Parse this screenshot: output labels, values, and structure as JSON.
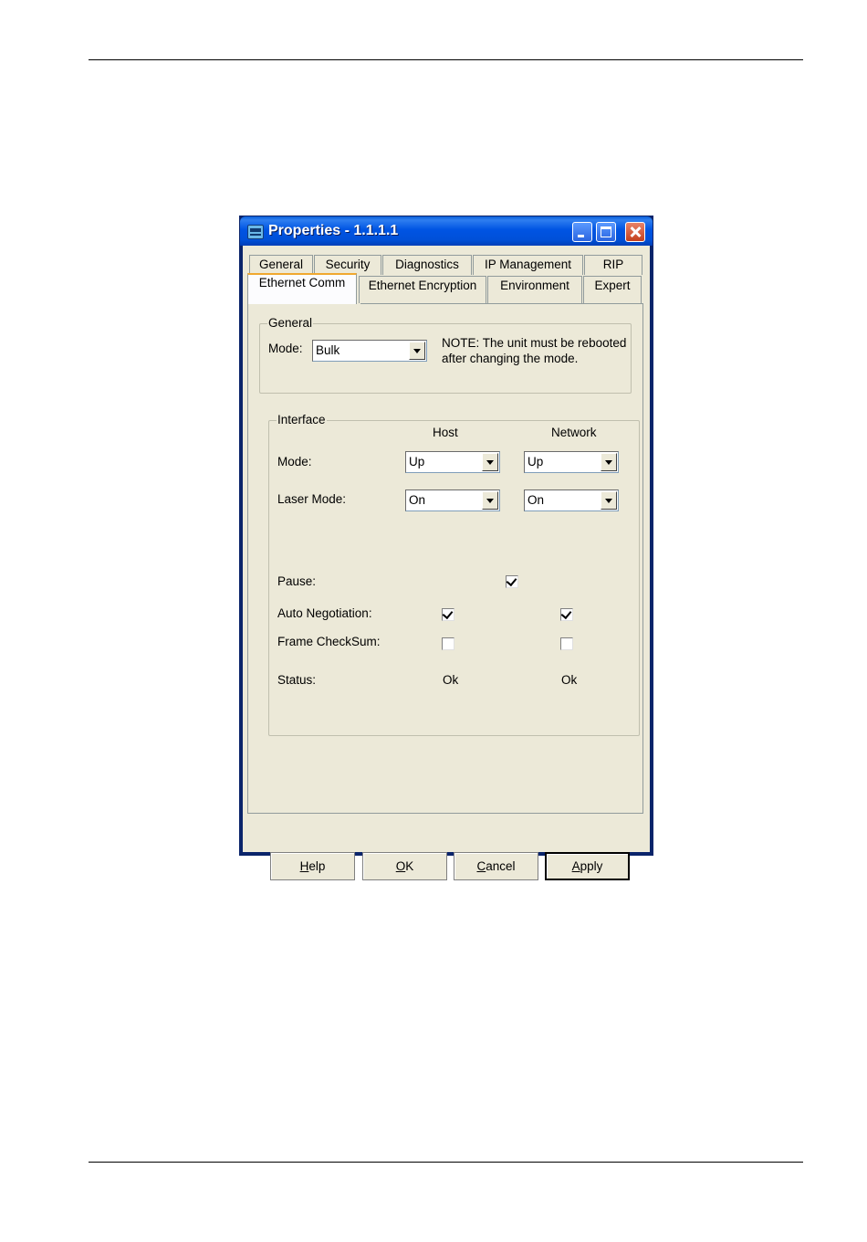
{
  "dialog": {
    "title": "Properties - 1.1.1.1",
    "tabs_row1": [
      "General",
      "Security",
      "Diagnostics",
      "IP Management",
      "RIP"
    ],
    "tabs_row2": [
      "Ethernet Comm",
      "Ethernet Encryption",
      "Environment",
      "Expert"
    ],
    "active_tab": "Ethernet Comm"
  },
  "general_group": {
    "legend": "General",
    "mode_label": "Mode:",
    "mode_value": "Bulk",
    "note_line1": "NOTE: The unit must be rebooted",
    "note_line2": "after changing the mode."
  },
  "interface_group": {
    "legend": "Interface",
    "col_host": "Host",
    "col_network": "Network",
    "mode_label": "Mode:",
    "host_mode": "Up",
    "network_mode": "Up",
    "laser_label": "Laser Mode:",
    "host_laser": "On",
    "network_laser": "On",
    "pause_label": "Pause:",
    "pause_checked": true,
    "autoneg_label": "Auto Negotiation:",
    "host_autoneg": true,
    "network_autoneg": true,
    "checksum_label": "Frame CheckSum:",
    "host_checksum": false,
    "network_checksum": false,
    "status_label": "Status:",
    "host_status": "Ok",
    "network_status": "Ok"
  },
  "buttons": {
    "help": {
      "key": "H",
      "rest": "elp"
    },
    "ok": {
      "key": "O",
      "rest": "K"
    },
    "cancel": {
      "key": "C",
      "rest": "ancel"
    },
    "apply": {
      "key": "A",
      "rest": "pply"
    }
  }
}
